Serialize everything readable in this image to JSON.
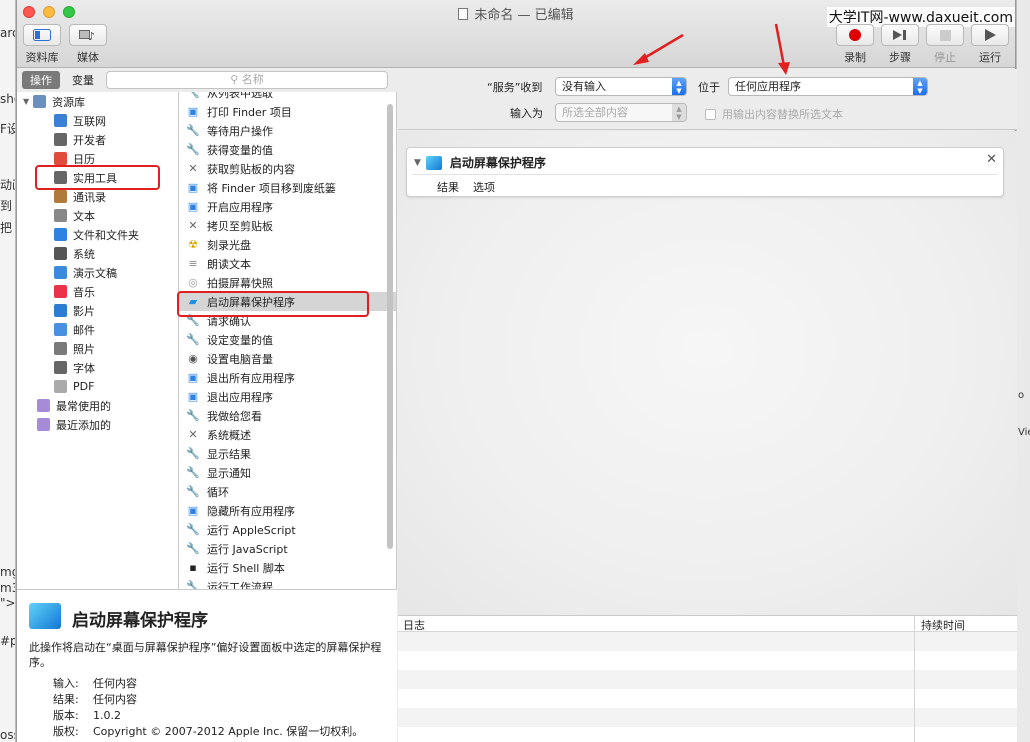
{
  "background": {
    "left_fragments": [
      "arc",
      "sho",
      "F设",
      "动画",
      "到",
      "把",
      "mg",
      "m3",
      "\">",
      "#p",
      "oss"
    ],
    "right_fragments": [
      "o",
      "Vie"
    ]
  },
  "window": {
    "title": "未命名 — 已编辑",
    "watermark": "大学IT网-www.daxueit.com"
  },
  "toolbar": {
    "library_label": "资料库",
    "media_label": "媒体",
    "record_label": "录制",
    "step_label": "步骤",
    "stop_label": "停止",
    "run_label": "运行"
  },
  "tabs": {
    "actions_label": "操作",
    "variables_label": "变量"
  },
  "search": {
    "placeholder": "名称"
  },
  "library": {
    "root": "资源库",
    "items": [
      {
        "label": "互联网",
        "icon": "globe-icon",
        "color": "#3c7fd6"
      },
      {
        "label": "开发者",
        "icon": "tools-icon",
        "color": "#666"
      },
      {
        "label": "日历",
        "icon": "calendar-icon",
        "color": "#e04b3b"
      },
      {
        "label": "实用工具",
        "icon": "tools-icon",
        "color": "#666"
      },
      {
        "label": "通讯录",
        "icon": "contacts-icon",
        "color": "#b07a3b"
      },
      {
        "label": "文本",
        "icon": "text-icon",
        "color": "#888"
      },
      {
        "label": "文件和文件夹",
        "icon": "finder-icon",
        "color": "#2f82e0"
      },
      {
        "label": "系统",
        "icon": "system-icon",
        "color": "#555"
      },
      {
        "label": "演示文稿",
        "icon": "keynote-icon",
        "color": "#3c8ae0"
      },
      {
        "label": "音乐",
        "icon": "music-icon",
        "color": "#e8334a"
      },
      {
        "label": "影片",
        "icon": "movie-icon",
        "color": "#2b7cd5"
      },
      {
        "label": "邮件",
        "icon": "mail-icon",
        "color": "#4a90e2"
      },
      {
        "label": "照片",
        "icon": "photo-icon",
        "color": "#7a7a7a"
      },
      {
        "label": "字体",
        "icon": "font-icon",
        "color": "#666"
      },
      {
        "label": "PDF",
        "icon": "pdf-icon",
        "color": "#aaa"
      }
    ],
    "recent_used": "最常使用的",
    "recent_added": "最近添加的"
  },
  "actions": [
    {
      "label": "从列表中选取",
      "icon": "automator-icon"
    },
    {
      "label": "打印 Finder 项目",
      "icon": "finder-icon"
    },
    {
      "label": "等待用户操作",
      "icon": "automator-icon"
    },
    {
      "label": "获得变量的值",
      "icon": "automator-icon"
    },
    {
      "label": "获取剪贴板的内容",
      "icon": "tools-icon"
    },
    {
      "label": "将 Finder 项目移到废纸篓",
      "icon": "finder-icon"
    },
    {
      "label": "开启应用程序",
      "icon": "finder-icon"
    },
    {
      "label": "拷贝至剪贴板",
      "icon": "tools-icon"
    },
    {
      "label": "刻录光盘",
      "icon": "radiation-icon"
    },
    {
      "label": "朗读文本",
      "icon": "text-icon"
    },
    {
      "label": "拍摄屏幕快照",
      "icon": "preview-icon"
    },
    {
      "label": "启动屏幕保护程序",
      "icon": "screensaver-icon"
    },
    {
      "label": "请求确认",
      "icon": "automator-icon"
    },
    {
      "label": "设定变量的值",
      "icon": "automator-icon"
    },
    {
      "label": "设置电脑音量",
      "icon": "system-icon"
    },
    {
      "label": "退出所有应用程序",
      "icon": "finder-icon"
    },
    {
      "label": "退出应用程序",
      "icon": "finder-icon"
    },
    {
      "label": "我做给您看",
      "icon": "automator-icon"
    },
    {
      "label": "系统概述",
      "icon": "tools-icon"
    },
    {
      "label": "显示结果",
      "icon": "automator-icon"
    },
    {
      "label": "显示通知",
      "icon": "automator-icon"
    },
    {
      "label": "循环",
      "icon": "automator-icon"
    },
    {
      "label": "隐藏所有应用程序",
      "icon": "finder-icon"
    },
    {
      "label": "运行 AppleScript",
      "icon": "automator-icon"
    },
    {
      "label": "运行 JavaScript",
      "icon": "automator-icon"
    },
    {
      "label": "运行 Shell 脚本",
      "icon": "terminal-icon"
    },
    {
      "label": "运行工作流程",
      "icon": "automator-icon"
    }
  ],
  "selected_action_index": 11,
  "description": {
    "title": "启动屏幕保护程序",
    "text": "此操作将启动在“桌面与屏幕保护程序”偏好设置面板中选定的屏幕保护程序。",
    "input_key": "输入:",
    "input_val": "任何内容",
    "result_key": "结果:",
    "result_val": "任何内容",
    "version_key": "版本:",
    "version_val": "1.0.2",
    "copyright_key": "版权:",
    "copyright_val": "Copyright © 2007-2012 Apple Inc. 保留一切权利。"
  },
  "workflow": {
    "service_receives_label": "“服务”收到",
    "service_receives_value": "没有输入",
    "in_label": "位于",
    "in_value": "任何应用程序",
    "input_is_label": "输入为",
    "input_is_value": "所选全部内容",
    "replace_checkbox_label": "用输出内容替换所选文本"
  },
  "workflow_action": {
    "title": "启动屏幕保护程序",
    "tab_results": "结果",
    "tab_options": "选项"
  },
  "log": {
    "col_log": "日志",
    "col_duration": "持续时间"
  },
  "colors": {
    "highlight": "#e02020",
    "accent_blue": "#1a6ef0"
  }
}
